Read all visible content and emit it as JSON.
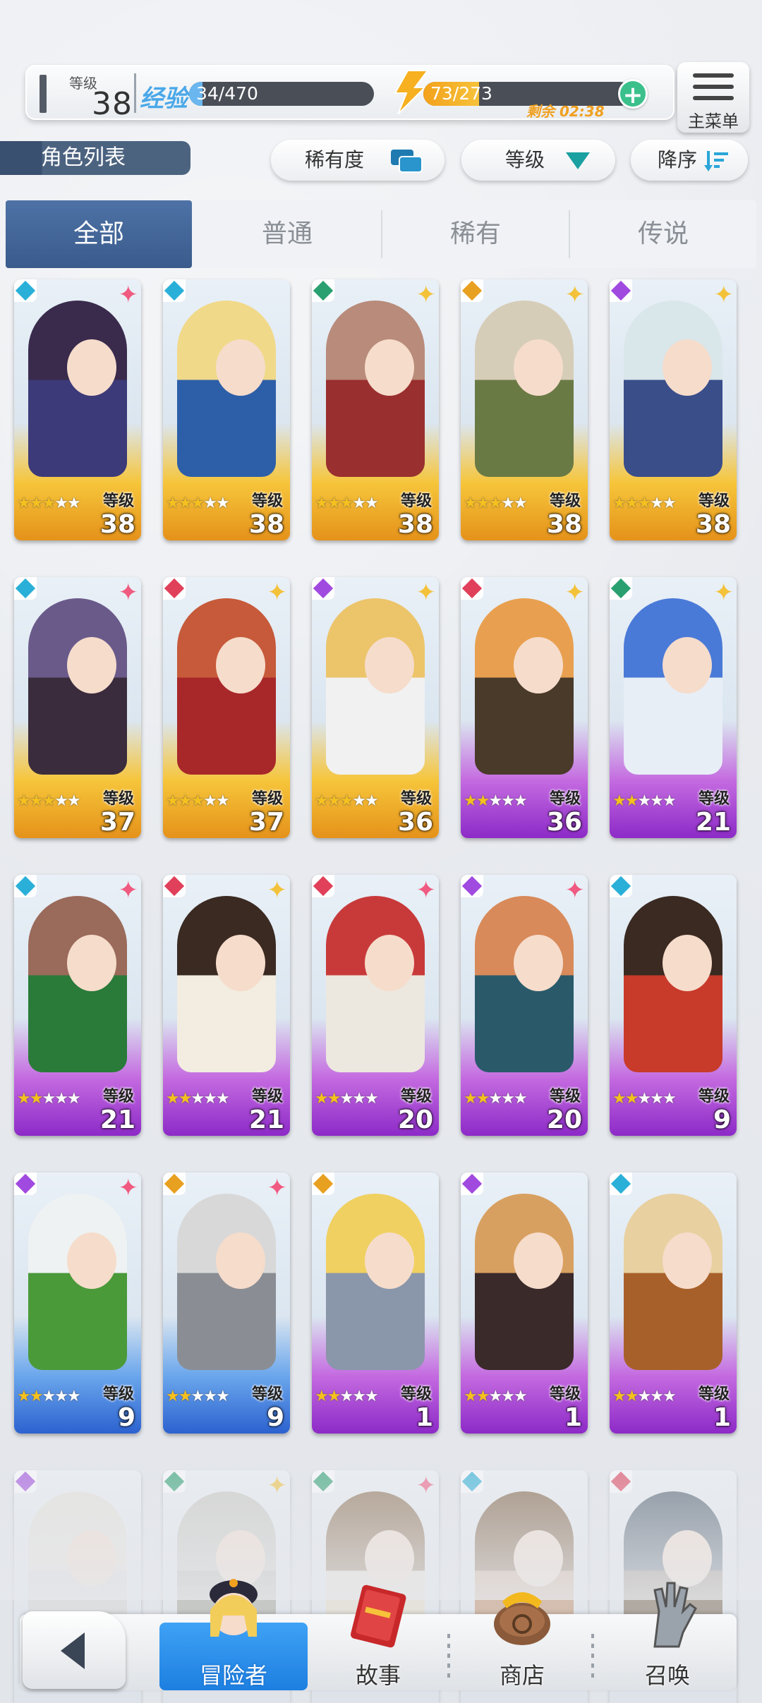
{
  "header": {
    "level_label": "等级",
    "level": "38",
    "exp_tag": "经验",
    "exp_text": "34/470",
    "exp_fraction": 0.072,
    "stamina_text": "73/273",
    "stamina_fraction": 0.267,
    "remain_text": "剩余 02:38",
    "menu_label": "主菜单"
  },
  "toolbar": {
    "section_title": "角色列表",
    "sort_rarity": "稀有度",
    "sort_level": "等级",
    "sort_order": "降序"
  },
  "tabs": [
    "全部",
    "普通",
    "稀有",
    "传说"
  ],
  "card_level_label": "等级",
  "cards": [
    {
      "level": "38",
      "stars": 3,
      "rarity": "gold",
      "element": "blue",
      "hair": "#3a2b4d",
      "robe": "#3c3a78",
      "spark": "pink"
    },
    {
      "level": "38",
      "stars": 3,
      "rarity": "gold",
      "element": "blue",
      "hair": "#f1d98a",
      "robe": "#2d5fa8",
      "spark": ""
    },
    {
      "level": "38",
      "stars": 3,
      "rarity": "gold",
      "element": "green",
      "hair": "#b88b7a",
      "robe": "#9a2f2f",
      "spark": "gold"
    },
    {
      "level": "38",
      "stars": 3,
      "rarity": "gold",
      "element": "yellow",
      "hair": "#d6cdb8",
      "robe": "#6a7a45",
      "spark": "gold"
    },
    {
      "level": "38",
      "stars": 3,
      "rarity": "gold",
      "element": "purple",
      "hair": "#d9e6ea",
      "robe": "#3a4e8a",
      "spark": "gold"
    },
    {
      "level": "37",
      "stars": 3,
      "rarity": "gold",
      "element": "blue",
      "hair": "#6a5a8a",
      "robe": "#3a2c3c",
      "spark": "pink"
    },
    {
      "level": "37",
      "stars": 3,
      "rarity": "gold",
      "element": "red",
      "hair": "#c65a3a",
      "robe": "#a8282a",
      "spark": "gold"
    },
    {
      "level": "36",
      "stars": 3,
      "rarity": "gold",
      "element": "purple",
      "hair": "#ecc46a",
      "robe": "#f1f1f1",
      "spark": "gold"
    },
    {
      "level": "36",
      "stars": 2,
      "rarity": "purple",
      "element": "red",
      "hair": "#e8a050",
      "robe": "#4a3a2a",
      "spark": "gold"
    },
    {
      "level": "21",
      "stars": 2,
      "rarity": "purple",
      "element": "green",
      "hair": "#4a7ad8",
      "robe": "#e8eef6",
      "spark": "gold"
    },
    {
      "level": "21",
      "stars": 2,
      "rarity": "purple",
      "element": "blue",
      "hair": "#9a6a5a",
      "robe": "#2a7a3a",
      "spark": "pink"
    },
    {
      "level": "21",
      "stars": 2,
      "rarity": "purple",
      "element": "red",
      "hair": "#3a2a22",
      "robe": "#f2ede0",
      "spark": "gold"
    },
    {
      "level": "20",
      "stars": 2,
      "rarity": "purple",
      "element": "red",
      "hair": "#c83a3a",
      "robe": "#ece8e0",
      "spark": "pink"
    },
    {
      "level": "20",
      "stars": 2,
      "rarity": "purple",
      "element": "purple",
      "hair": "#d88a5a",
      "robe": "#2a5a6a",
      "spark": "pink"
    },
    {
      "level": "9",
      "stars": 2,
      "rarity": "purple",
      "element": "blue",
      "hair": "#3a2a22",
      "robe": "#c83a2a",
      "spark": ""
    },
    {
      "level": "9",
      "stars": 2,
      "rarity": "blue",
      "element": "purple",
      "hair": "#eef2f2",
      "robe": "#4a9a3a",
      "spark": "pink"
    },
    {
      "level": "9",
      "stars": 2,
      "rarity": "blue",
      "element": "yellow",
      "hair": "#d8d8d8",
      "robe": "#8a8e94",
      "spark": "pink"
    },
    {
      "level": "1",
      "stars": 2,
      "rarity": "purple",
      "element": "yellow",
      "hair": "#f0d060",
      "robe": "#8a96aa",
      "spark": ""
    },
    {
      "level": "1",
      "stars": 2,
      "rarity": "purple",
      "element": "purple",
      "hair": "#d8a060",
      "robe": "#3a2a2a",
      "spark": ""
    },
    {
      "level": "1",
      "stars": 2,
      "rarity": "purple",
      "element": "blue",
      "hair": "#e8d0a0",
      "robe": "#a8602a",
      "spark": ""
    },
    {
      "level": "",
      "stars": 0,
      "rarity": "none",
      "element": "purple",
      "hair": "#e8e4dc",
      "robe": "#d8d8d8",
      "spark": ""
    },
    {
      "level": "",
      "stars": 0,
      "rarity": "none",
      "element": "green",
      "hair": "#c8c8c0",
      "robe": "#b0b0a8",
      "spark": "gold"
    },
    {
      "level": "",
      "stars": 0,
      "rarity": "none",
      "element": "green",
      "hair": "#8a6a4a",
      "robe": "#e8e0d0",
      "spark": "pink"
    },
    {
      "level": "",
      "stars": 0,
      "rarity": "none",
      "element": "blue",
      "hair": "#7a5a3a",
      "robe": "#c8a080",
      "spark": ""
    },
    {
      "level": "",
      "stars": 0,
      "rarity": "none",
      "element": "red",
      "hair": "#4a5a6a",
      "robe": "#8a7a6a",
      "spark": ""
    }
  ],
  "nav": {
    "adventurer": "冒险者",
    "story": "故事",
    "shop": "商店",
    "summon": "召唤"
  },
  "colors": {
    "accent_blue": "#3a5b8c",
    "gold": "#f3b81e",
    "purple": "#a33ad8",
    "blue": "#3a7ae0",
    "stamina": "#f3a11b",
    "plus": "#3bc08c"
  },
  "icons": {
    "stamina": "lightning-bolt-icon",
    "add": "plus-icon",
    "menu": "hamburger-icon",
    "back": "back-arrow-icon",
    "sort_rarity": "cards-icon",
    "sort_level": "triangle-down-icon",
    "sort_order": "sort-desc-icon"
  }
}
